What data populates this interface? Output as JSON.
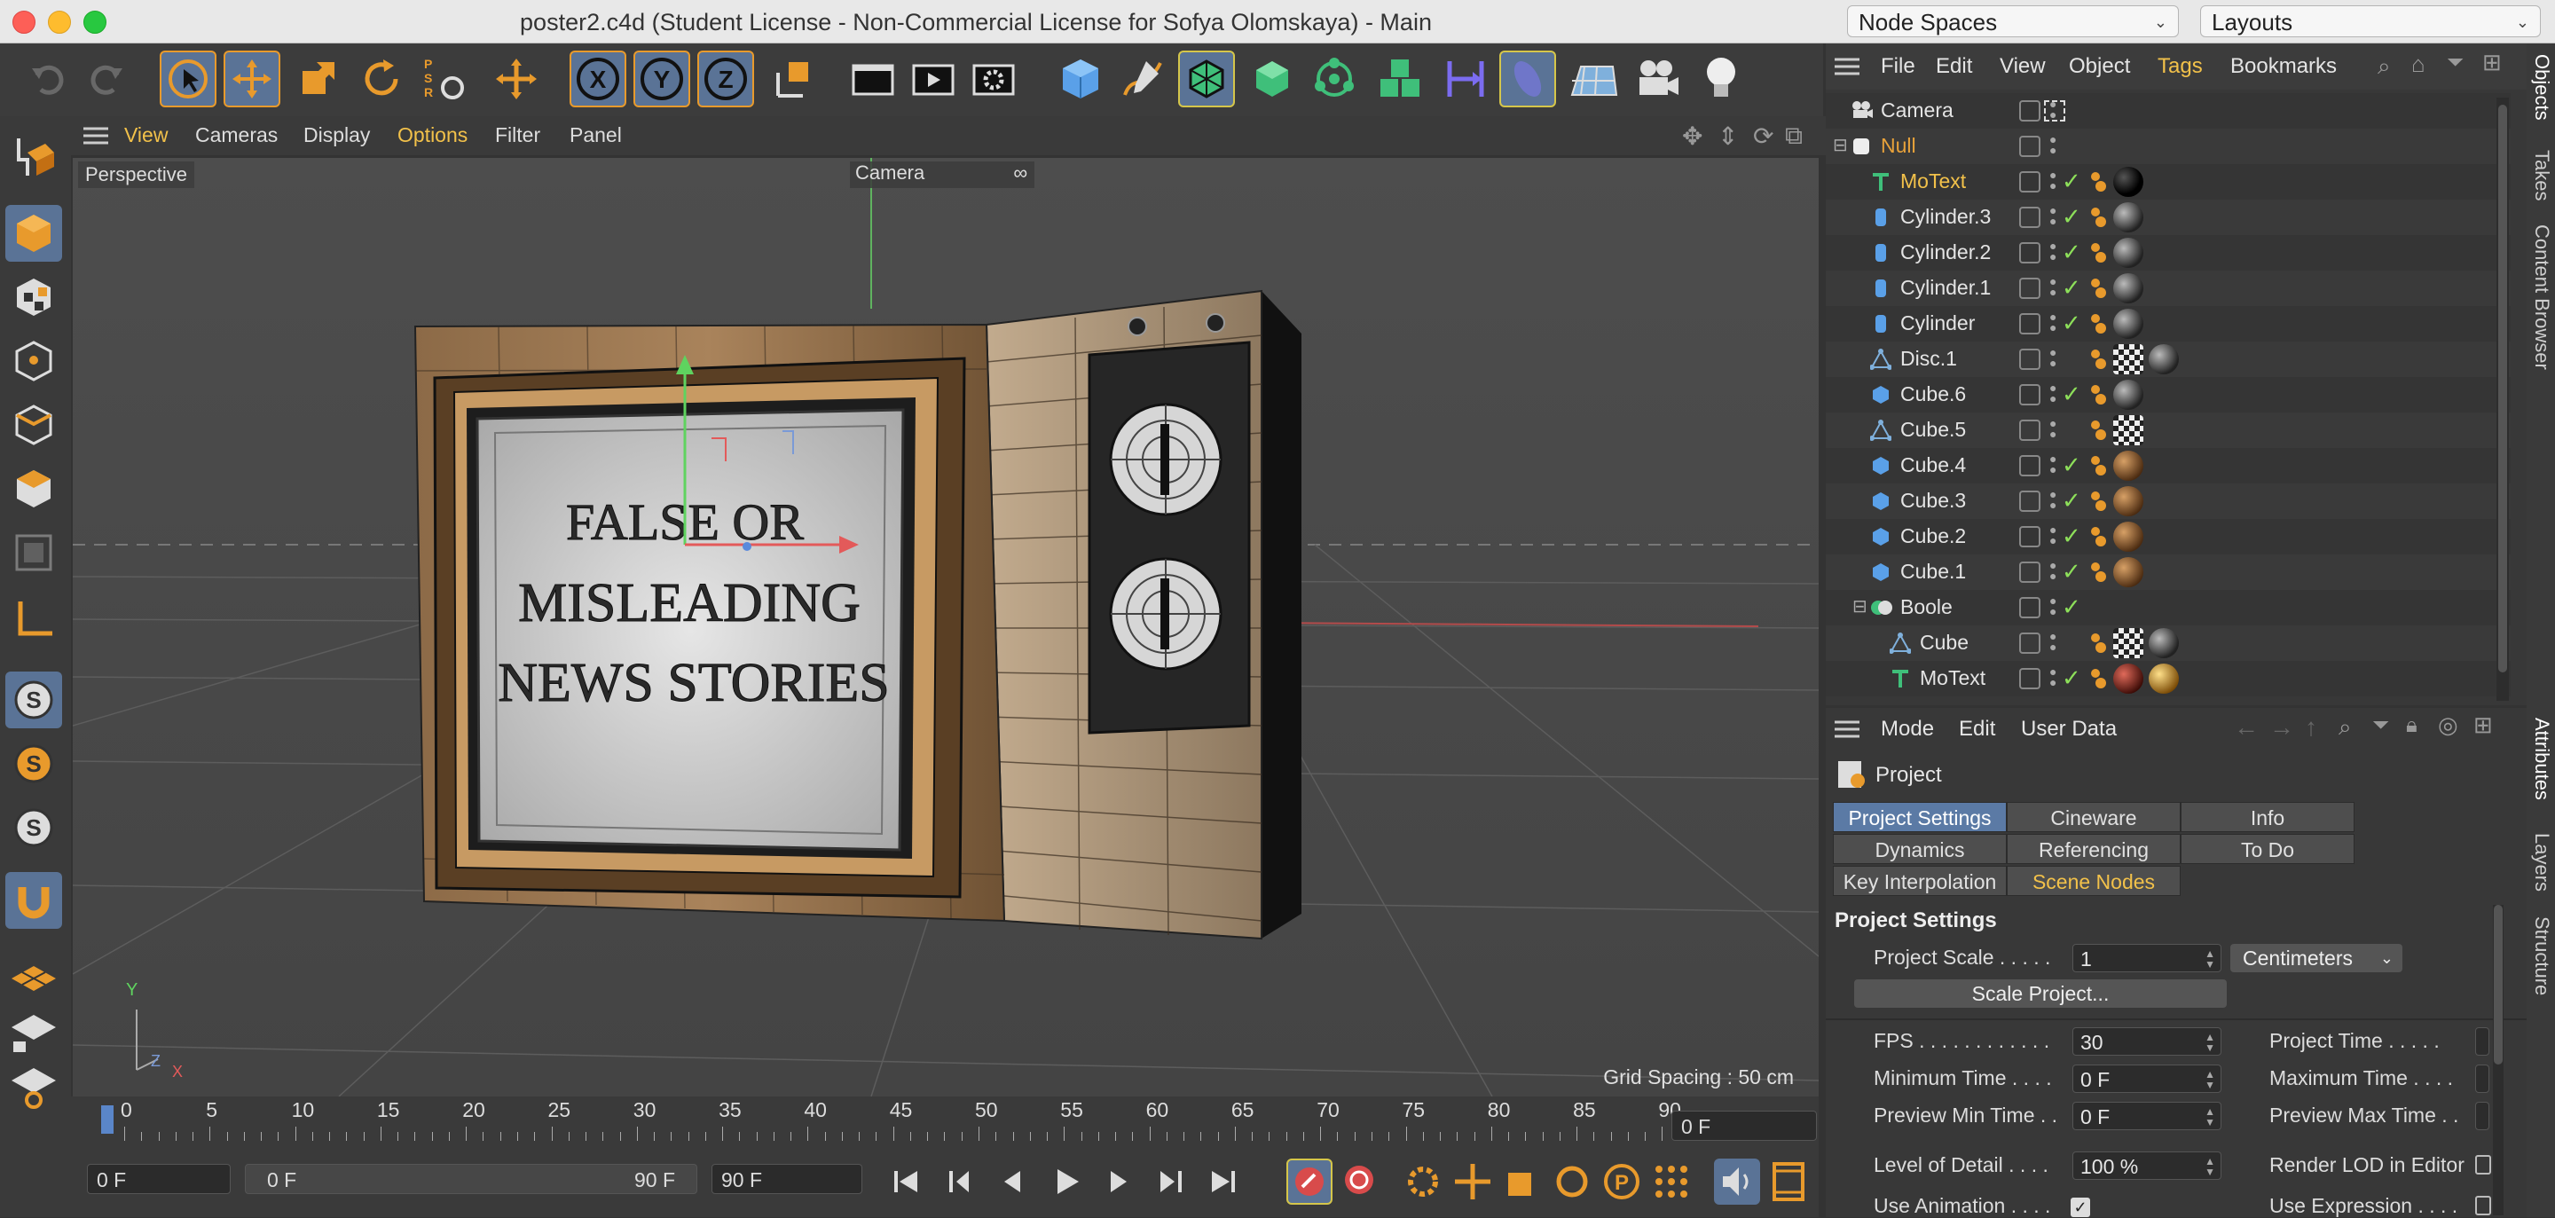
{
  "window": {
    "title": "poster2.c4d (Student License - Non-Commercial License for Sofya Olomskaya) - Main",
    "node_spaces": "Node Spaces",
    "layouts": "Layouts"
  },
  "viewport": {
    "menu": [
      "View",
      "Cameras",
      "Display",
      "Options",
      "Filter",
      "Panel"
    ],
    "active_menu": "Options",
    "view_label": "Perspective",
    "camera_label": "Camera",
    "grid_spacing": "Grid Spacing : 50 cm",
    "screen_text": [
      "FALSE OR",
      "MISLEADING",
      "NEWS STORIES"
    ],
    "axes": {
      "y": "Y",
      "z": "Z",
      "x": "X"
    }
  },
  "timeline": {
    "ticks": [
      "0",
      "5",
      "10",
      "15",
      "20",
      "25",
      "30",
      "35",
      "40",
      "45",
      "50",
      "55",
      "60",
      "65",
      "70",
      "75",
      "80",
      "85",
      "90"
    ],
    "current_frame": "0 F",
    "start": "0 F",
    "range_start": "0 F",
    "range_end": "90 F",
    "end": "90 F"
  },
  "object_manager": {
    "menu": [
      "File",
      "Edit",
      "View",
      "Object",
      "Tags",
      "Bookmarks"
    ],
    "active_menu": "Tags",
    "objects": [
      {
        "name": "Camera",
        "type": "camera",
        "indent": 0,
        "color": "#e4e4e4",
        "check": false,
        "tags": [
          "camera-target"
        ]
      },
      {
        "name": "Null",
        "type": "null",
        "indent": 0,
        "color": "#e8a23a",
        "check": false,
        "tags": []
      },
      {
        "name": "MoText",
        "type": "motext",
        "indent": 1,
        "color": "#f2c14a",
        "check": true,
        "tags": [
          "orange-dot",
          "black-sphere"
        ]
      },
      {
        "name": "Cylinder.3",
        "type": "cylinder",
        "indent": 1,
        "color": "#e4e4e4",
        "check": true,
        "tags": [
          "orange-dot",
          "grey-sphere"
        ]
      },
      {
        "name": "Cylinder.2",
        "type": "cylinder",
        "indent": 1,
        "color": "#e4e4e4",
        "check": true,
        "tags": [
          "orange-dot",
          "grey-sphere"
        ]
      },
      {
        "name": "Cylinder.1",
        "type": "cylinder",
        "indent": 1,
        "color": "#e4e4e4",
        "check": true,
        "tags": [
          "orange-dot",
          "grey-sphere"
        ]
      },
      {
        "name": "Cylinder",
        "type": "cylinder",
        "indent": 1,
        "color": "#e4e4e4",
        "check": true,
        "tags": [
          "orange-dot",
          "grey-sphere"
        ]
      },
      {
        "name": "Disc.1",
        "type": "disc",
        "indent": 1,
        "color": "#e4e4e4",
        "check": false,
        "tags": [
          "orange-dot",
          "checker",
          "grey-sphere"
        ]
      },
      {
        "name": "Cube.6",
        "type": "cube",
        "indent": 1,
        "color": "#e4e4e4",
        "check": true,
        "tags": [
          "orange-dot",
          "grey-sphere"
        ]
      },
      {
        "name": "Cube.5",
        "type": "disc",
        "indent": 1,
        "color": "#e4e4e4",
        "check": false,
        "tags": [
          "orange-dot",
          "checker"
        ]
      },
      {
        "name": "Cube.4",
        "type": "cube",
        "indent": 1,
        "color": "#e4e4e4",
        "check": true,
        "tags": [
          "orange-dot",
          "wood-sphere"
        ]
      },
      {
        "name": "Cube.3",
        "type": "cube",
        "indent": 1,
        "color": "#e4e4e4",
        "check": true,
        "tags": [
          "orange-dot",
          "wood-sphere"
        ]
      },
      {
        "name": "Cube.2",
        "type": "cube",
        "indent": 1,
        "color": "#e4e4e4",
        "check": true,
        "tags": [
          "orange-dot",
          "wood-sphere"
        ]
      },
      {
        "name": "Cube.1",
        "type": "cube",
        "indent": 1,
        "color": "#e4e4e4",
        "check": true,
        "tags": [
          "orange-dot",
          "wood-sphere"
        ]
      },
      {
        "name": "Boole",
        "type": "boole",
        "indent": 1,
        "color": "#e4e4e4",
        "check": true,
        "tags": []
      },
      {
        "name": "Cube",
        "type": "disc",
        "indent": 2,
        "color": "#e4e4e4",
        "check": false,
        "tags": [
          "orange-dot",
          "checker",
          "grey-sphere"
        ]
      },
      {
        "name": "MoText",
        "type": "motext",
        "indent": 2,
        "color": "#e4e4e4",
        "check": true,
        "tags": [
          "orange-dot",
          "red-sphere",
          "gold-sphere"
        ]
      }
    ]
  },
  "attributes": {
    "menu": [
      "Mode",
      "Edit",
      "User Data"
    ],
    "object_title": "Project",
    "tabs_row1": [
      "Project Settings",
      "Cineware",
      "Info"
    ],
    "tabs_row2": [
      "Dynamics",
      "Referencing",
      "To Do"
    ],
    "tabs_row3": [
      "Key Interpolation",
      "Scene Nodes"
    ],
    "active_tab": "Project Settings",
    "section_title": "Project Settings",
    "project_scale_label": "Project Scale . . . . .",
    "project_scale_value": "1",
    "project_scale_unit": "Centimeters",
    "scale_button": "Scale Project...",
    "fields": [
      {
        "label": "FPS . . . . . . . . . . . .",
        "value": "30",
        "right_label": "Project Time . . . . ."
      },
      {
        "label": "Minimum Time . . . .",
        "value": "0 F",
        "right_label": "Maximum Time . . . ."
      },
      {
        "label": "Preview Min Time . .",
        "value": "0 F",
        "right_label": "Preview Max Time . ."
      },
      {
        "label": "Level of Detail . . . .",
        "value": "100 %",
        "right_label": "Render LOD in Editor"
      },
      {
        "label": "Use Animation . . . .",
        "value": "",
        "right_label": "Use Expression . . . ."
      }
    ]
  },
  "side_tabs": [
    "Objects",
    "Takes",
    "Content Browser",
    "Attributes",
    "Layers",
    "Structure"
  ],
  "colors": {
    "accent_orange": "#e89a2c",
    "selection_blue": "#5a7396",
    "check_green": "#8ddf5a"
  }
}
